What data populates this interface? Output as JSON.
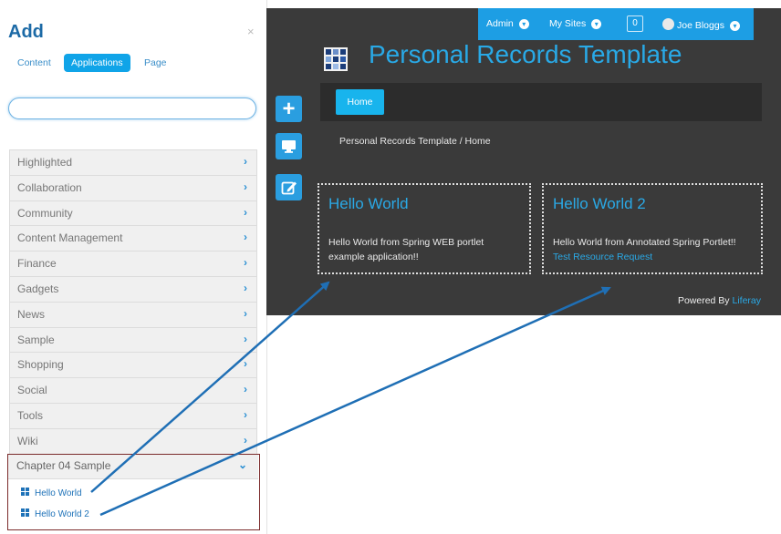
{
  "add_panel": {
    "title": "Add",
    "close": "×",
    "tabs": [
      "Content",
      "Applications",
      "Page"
    ],
    "active_tab": "Applications",
    "search": {
      "value": "",
      "placeholder": ""
    },
    "categories": [
      "Highlighted",
      "Collaboration",
      "Community",
      "Content Management",
      "Finance",
      "Gadgets",
      "News",
      "Sample",
      "Shopping",
      "Social",
      "Tools",
      "Wiki"
    ],
    "chevron_right": "›",
    "expanded_category": {
      "label": "Chapter 04 Sample",
      "chevron": "⌄",
      "apps": [
        "Hello World",
        "Hello World 2"
      ]
    }
  },
  "portal": {
    "topbar": {
      "admin": "Admin",
      "my_sites": "My Sites",
      "notifications": "0",
      "user": "Joe Bloggs",
      "menu_chevron": "▾"
    },
    "site_title": "Personal Records Template",
    "nav": {
      "home": "Home"
    },
    "breadcrumb": "Personal Records Template / Home",
    "side_buttons": {
      "add": "+"
    },
    "portlets": [
      {
        "title": "Hello World",
        "body": "Hello World from Spring WEB portlet example application!!"
      },
      {
        "title": "Hello World 2",
        "body": "Hello World from Annotated Spring Portlet!!",
        "link": "Test Resource Request"
      }
    ],
    "footer": {
      "powered_by": "Powered By",
      "liferay": "Liferay"
    }
  },
  "colors": {
    "accent": "#1d9ee4",
    "portal_bg": "#3a3a3a",
    "title_blue": "#29a9e6",
    "highlight_border": "#7b2b2b",
    "arrow": "#1f6fb5"
  }
}
